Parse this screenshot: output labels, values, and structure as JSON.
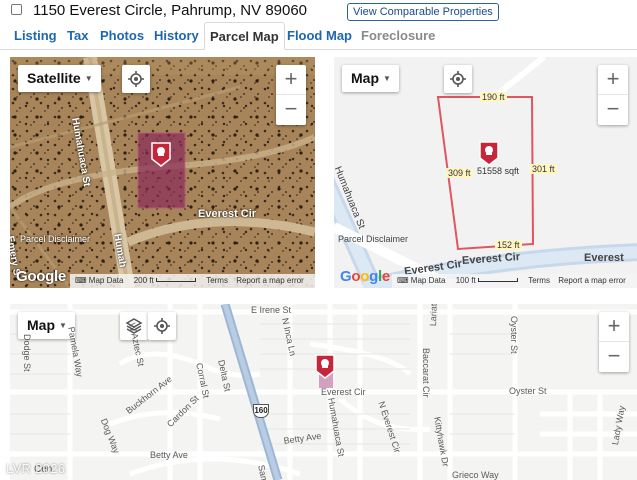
{
  "header": {
    "address": "1150 Everest Circle, Pahrump, NV 89060",
    "comparable_button": "View Comparable Properties"
  },
  "tabs": [
    {
      "label": "Listing",
      "state": "link"
    },
    {
      "label": "Tax",
      "state": "link"
    },
    {
      "label": "Photos",
      "state": "link"
    },
    {
      "label": "History",
      "state": "link"
    },
    {
      "label": "Parcel Map",
      "state": "active"
    },
    {
      "label": "Flood Map",
      "state": "link"
    },
    {
      "label": "Foreclosure",
      "state": "disabled"
    }
  ],
  "satellite_map": {
    "type_label": "Satellite",
    "street_labels": [
      "Humahuaca St",
      "Everest Cir",
      "Humah",
      "Emery S"
    ],
    "disclaimer": "Parcel Disclaimer",
    "footer": {
      "map_data": "Map Data",
      "scale": "200 ft",
      "terms": "Terms",
      "report": "Report a map error"
    },
    "google": "Google"
  },
  "parcel_map": {
    "type_label": "Map",
    "dimensions": {
      "top": "190 ft",
      "left": "309 ft",
      "right": "301 ft",
      "bottom": "152 ft"
    },
    "area": "51558 sqft",
    "street_labels": [
      "Humahuaca St",
      "Everest Cir",
      "Everest Cir",
      "Everest"
    ],
    "disclaimer": "Parcel Disclaimer",
    "footer": {
      "map_data": "Map Data",
      "scale": "100 ft",
      "terms": "Terms",
      "report": "Report a map error"
    },
    "google": "Google"
  },
  "area_map": {
    "type_label": "Map",
    "street_labels": [
      "E Irene St",
      "Oyster St",
      "N Inca Ln",
      "W Aztec St",
      "Pamela Way",
      "Dodge St",
      "Lariat Ln",
      "Corral St",
      "Delta St",
      "Buckhorn Ave",
      "Cardon St",
      "Baccarat Cir",
      "Everest Cir",
      "Oyster St",
      "Humahuaca St",
      "N Everest Cir",
      "Kittyhawk Dr",
      "Dog Way",
      "Betty Ave",
      "Betty Ave",
      "Grieco Way",
      "Lady Way",
      "Sam",
      "Cen"
    ],
    "highway_shield": "160"
  },
  "watermark": "LVR 2026",
  "colors": {
    "link": "#1c67b0",
    "parcel_outline": "#e0555f",
    "pin": "#c6263a"
  }
}
